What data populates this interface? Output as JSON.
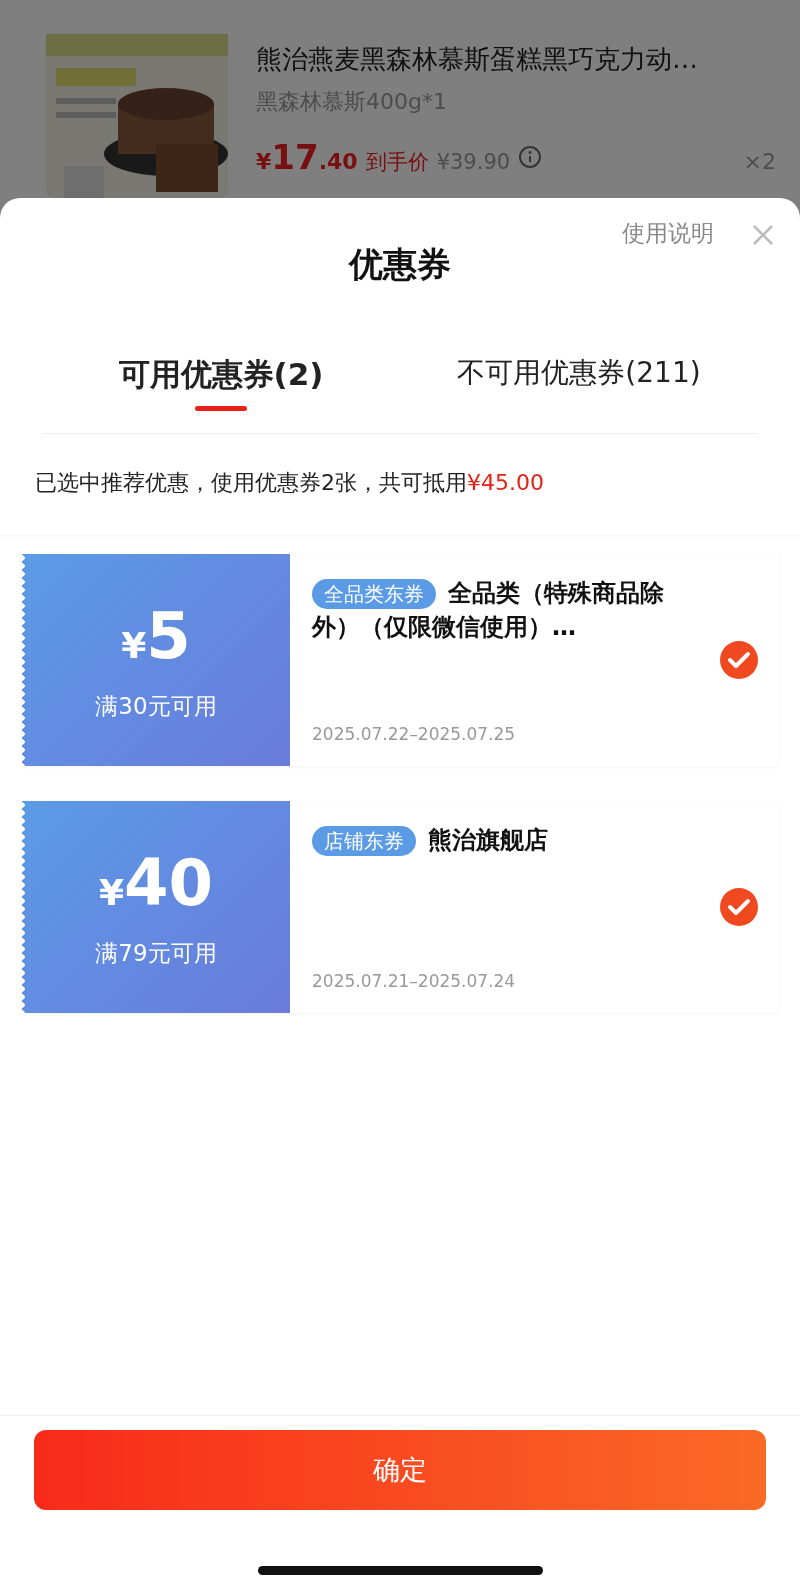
{
  "product": {
    "title": "熊治燕麦黑森林慕斯蛋糕黑巧克力动…",
    "spec": "黑森林慕斯400g*1",
    "price_symbol": "¥",
    "price_int": "17",
    "price_dec": ".40",
    "price_label": "到手价",
    "original_price": "¥39.90",
    "quantity": "×2"
  },
  "sheet": {
    "help_link": "使用说明",
    "title": "优惠券",
    "tabs": [
      {
        "label": "可用优惠券(2)",
        "selected": true
      },
      {
        "label": "不可用优惠券(211)",
        "selected": false
      }
    ],
    "summary_prefix": "已选中推荐优惠，使用优惠券2张，共可抵用",
    "summary_amount": "¥45.00",
    "coupons": [
      {
        "symbol": "¥",
        "amount": "5",
        "condition": "满30元可用",
        "tag": "全品类东券",
        "name": "全品类（特殊商品除外）（仅限微信使用）…",
        "validity": "2025.07.22–2025.07.25",
        "selected": true
      },
      {
        "symbol": "¥",
        "amount": "40",
        "condition": "满79元可用",
        "tag": "店铺东券",
        "name": "熊治旗舰店",
        "validity": "2025.07.21–2025.07.24",
        "selected": true
      }
    ],
    "confirm_button": "确定"
  }
}
